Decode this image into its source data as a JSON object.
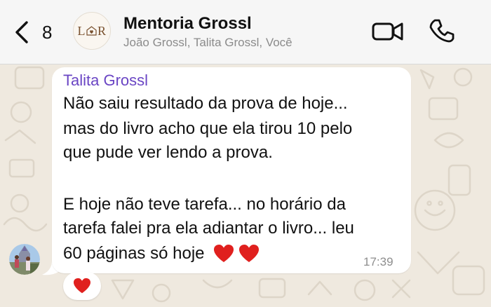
{
  "header": {
    "back_count": "8",
    "group_name": "Mentoria Grossl",
    "members": "João Grossl, Talita Grossl, Você",
    "avatar_logo": {
      "left": "L",
      "right": "R"
    }
  },
  "message": {
    "sender": "Talita Grossl",
    "lines": [
      "Não saiu resultado da prova de hoje...",
      "mas do livro acho que ela tirou 10 pelo",
      "que pude ver lendo a prova.",
      "",
      "E hoje não teve tarefa... no horário da",
      "tarefa falei pra ela adiantar o livro... leu",
      "60 páginas só hoje"
    ],
    "trailing_emoji": [
      "heart-icon",
      "heart-icon"
    ],
    "time": "17:39",
    "reaction": "heart-icon"
  },
  "icons": {
    "back": "chevron-left-icon",
    "video": "video-camera-icon",
    "phone": "phone-icon"
  },
  "colors": {
    "sender_name": "#6a45c4",
    "heart": "#e0201e",
    "wallpaper": "#efe9df",
    "header_bg": "#f6f6f6",
    "logo": "#7a5230"
  }
}
